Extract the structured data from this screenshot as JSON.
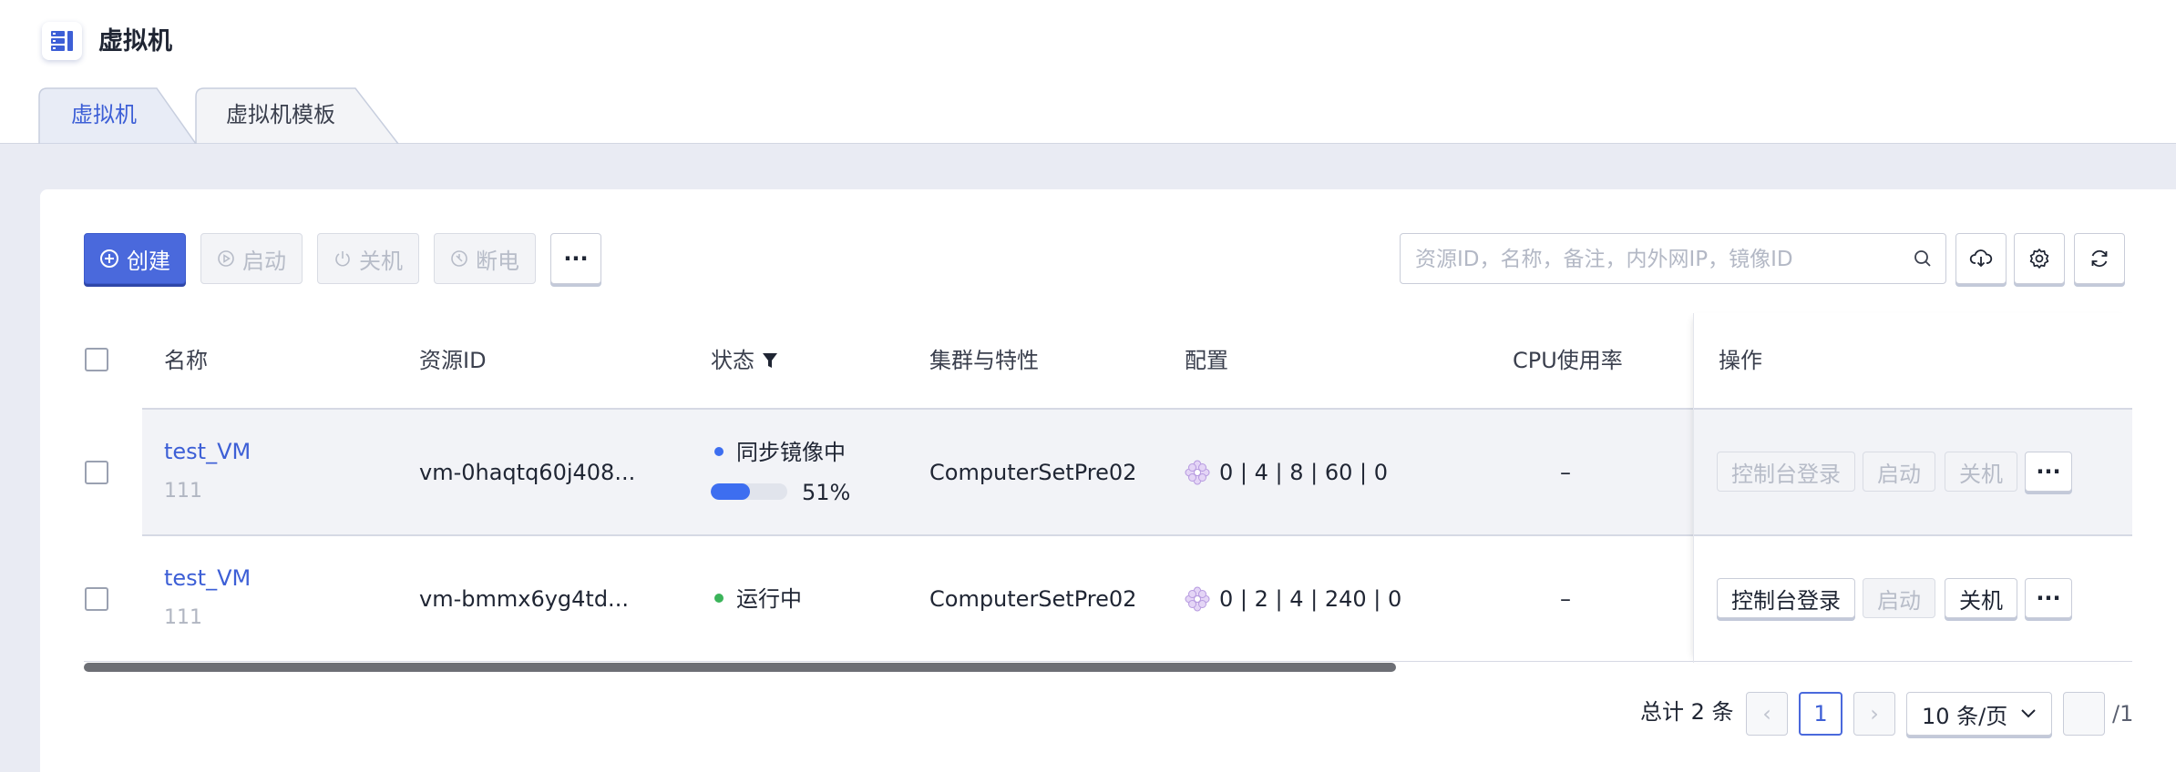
{
  "header": {
    "title": "虚拟机",
    "logo_icon": "server-list-icon",
    "tabs": [
      {
        "label": "虚拟机",
        "active": true
      },
      {
        "label": "虚拟机模板",
        "active": false
      }
    ]
  },
  "toolbar": {
    "create_label": "创建",
    "start_label": "启动",
    "shutdown_label": "关机",
    "poweroff_label": "断电",
    "more_label": "···",
    "search_placeholder": "资源ID，名称，备注，内外网IP，镜像ID",
    "icons": [
      "search-icon",
      "cloud-download-icon",
      "gear-icon",
      "refresh-icon"
    ]
  },
  "table": {
    "columns": [
      "名称",
      "资源ID",
      "状态",
      "集群与特性",
      "配置",
      "CPU使用率",
      "操作"
    ],
    "rows": [
      {
        "name": "test_VM",
        "remark": "111",
        "resource_id": "vm-0haqtq60j408...",
        "status": "同步镜像中",
        "status_color": "#3d6ef0",
        "progress_text": "51%",
        "progress": 0.51,
        "cluster": "ComputerSetPre02",
        "config": "0 | 4 | 8 | 60 | 0",
        "cpu_usage": "–",
        "actions": {
          "console": "控制台登录",
          "start": "启动",
          "shutdown": "关机",
          "more": "···"
        },
        "console_enabled": false,
        "start_enabled": false,
        "shutdown_enabled": false
      },
      {
        "name": "test_VM",
        "remark": "111",
        "resource_id": "vm-bmmx6yg4td...",
        "status": "运行中",
        "status_color": "#3bb45a",
        "cluster": "ComputerSetPre02",
        "config": "0 | 2 | 4 | 240 | 0",
        "cpu_usage": "–",
        "actions": {
          "console": "控制台登录",
          "start": "启动",
          "shutdown": "关机",
          "more": "···"
        },
        "console_enabled": true,
        "start_enabled": false,
        "shutdown_enabled": true
      }
    ]
  },
  "pagination": {
    "total_label": "总计 2 条",
    "prev": "‹",
    "current_page": "1",
    "next": "›",
    "page_size": "10 条/页",
    "page_input_value": "",
    "total_pages_label": "/1"
  },
  "colors": {
    "accent": "#4a69dc",
    "link": "#3d5fd6",
    "running": "#3bb45a",
    "syncing": "#3d6ef0"
  }
}
